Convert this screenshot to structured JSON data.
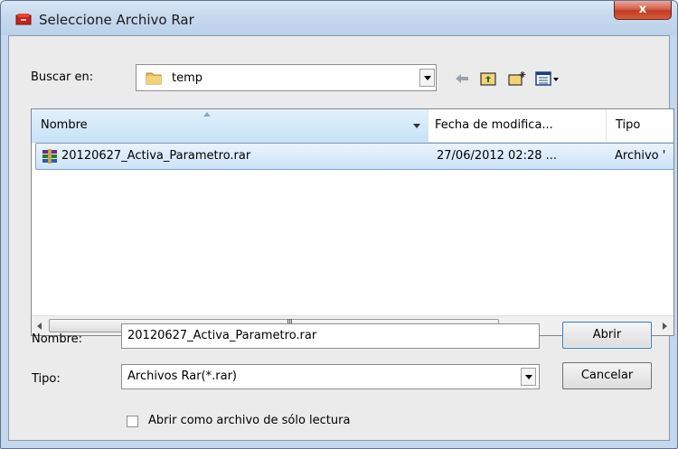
{
  "window": {
    "title": "Seleccione Archivo Rar",
    "close_label": "x"
  },
  "lookin": {
    "label": "Buscar en:",
    "value": "temp"
  },
  "toolbar": {
    "icons": [
      "back-arrow-icon",
      "up-folder-icon",
      "new-folder-icon",
      "view-menu-icon"
    ]
  },
  "list": {
    "columns": [
      "Nombre",
      "Fecha de modifica...",
      "Tipo"
    ],
    "rows": [
      {
        "name": "20120627_Activa_Parametro.rar",
        "date": "27/06/2012 02:28 ...",
        "type": "Archivo '"
      }
    ],
    "scroll_grip": "III"
  },
  "filename": {
    "label": "Nombre:",
    "value": "20120627_Activa_Parametro.rar"
  },
  "filetype": {
    "label": "Tipo:",
    "value": "Archivos Rar(*.rar)"
  },
  "buttons": {
    "open": "Abrir",
    "cancel": "Cancelar"
  },
  "readonly": {
    "label": "Abrir como archivo de sólo lectura",
    "checked": false
  },
  "colors": {
    "title_bg": "#c7d9ee",
    "close_red": "#c13a24",
    "selection": "#cce3f8",
    "client_bg": "#ebebeb"
  }
}
